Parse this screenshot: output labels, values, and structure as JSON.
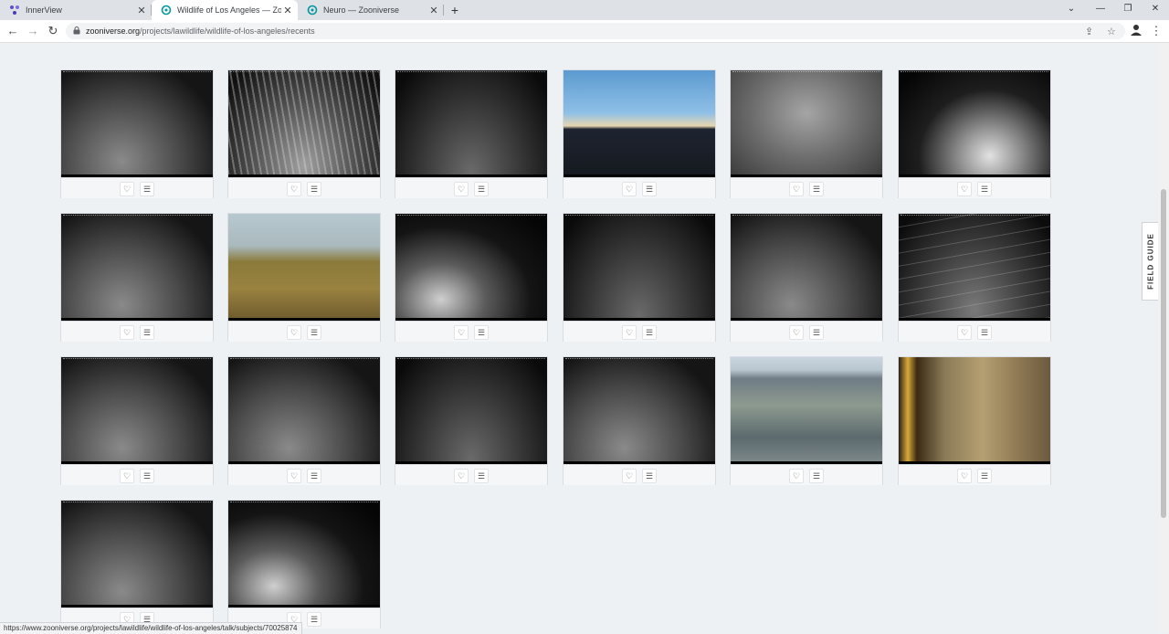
{
  "browser": {
    "tabs": [
      {
        "title": "InnerView",
        "active": false,
        "favicon": "innerview-logo-icon"
      },
      {
        "title": "Wildlife of Los Angeles — Zooniverse",
        "active": true,
        "favicon": "zooniverse-icon"
      },
      {
        "title": "Neuro — Zooniverse",
        "active": false,
        "favicon": "zooniverse-icon"
      }
    ],
    "new_tab_label": "+",
    "address": {
      "host": "zooniverse.org",
      "path": "/projects/lawildlife/wildlife-of-los-angeles/recents"
    },
    "status_url": "https://www.zooniverse.org/projects/lawildlife/wildlife-of-los-angeles/talk/subjects/70025874"
  },
  "page": {
    "field_guide_label": "FIELD GUIDE",
    "subjects": [
      {
        "kind": "ir",
        "scene": "brush"
      },
      {
        "kind": "ir",
        "scene": "grass-animal"
      },
      {
        "kind": "ir",
        "scene": "dark-ground"
      },
      {
        "kind": "color",
        "scene": "dusk-hill"
      },
      {
        "kind": "ir",
        "scene": "fog"
      },
      {
        "kind": "ir",
        "scene": "bright-grass"
      },
      {
        "kind": "ir",
        "scene": "brush"
      },
      {
        "kind": "color",
        "scene": "dry-grass"
      },
      {
        "kind": "ir",
        "scene": "plants-dark"
      },
      {
        "kind": "ir",
        "scene": "dark-ground"
      },
      {
        "kind": "ir",
        "scene": "brush"
      },
      {
        "kind": "ir",
        "scene": "branches"
      },
      {
        "kind": "ir",
        "scene": "brush"
      },
      {
        "kind": "ir",
        "scene": "brush"
      },
      {
        "kind": "ir",
        "scene": "dark-ground"
      },
      {
        "kind": "ir",
        "scene": "brush"
      },
      {
        "kind": "color",
        "scene": "hillside"
      },
      {
        "kind": "color",
        "scene": "rocks-trunk"
      },
      {
        "kind": "ir",
        "scene": "brush"
      },
      {
        "kind": "ir",
        "scene": "plants-dark"
      }
    ]
  }
}
